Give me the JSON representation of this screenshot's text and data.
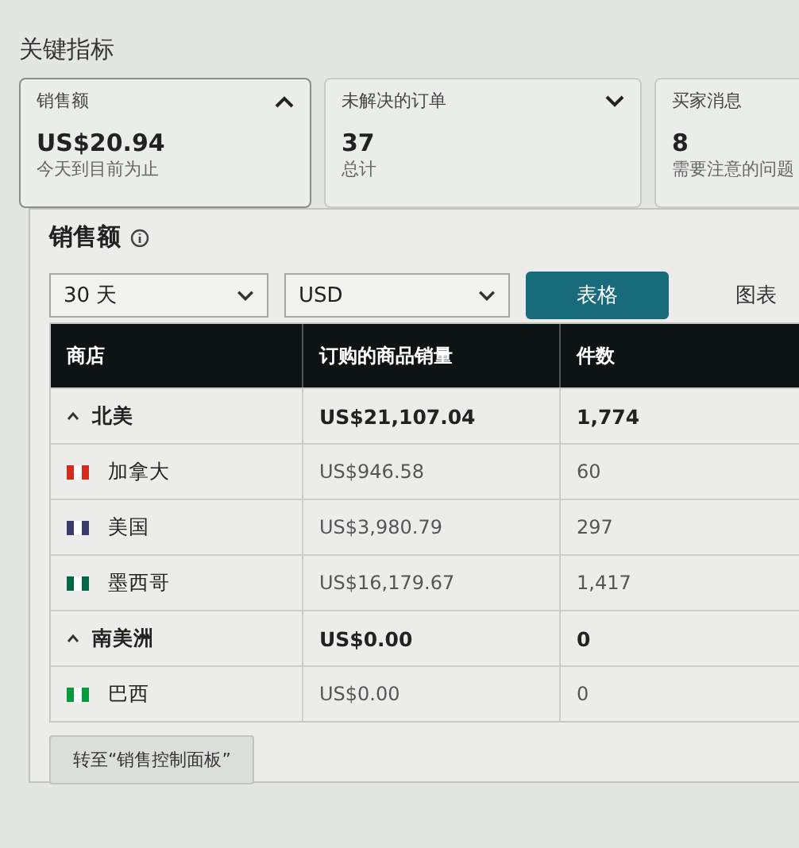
{
  "heading": "关键指标",
  "cards": [
    {
      "title": "销售额",
      "value": "US$20.94",
      "caption": "今天到目前为止",
      "expanded": true
    },
    {
      "title": "未解决的订单",
      "value": "37",
      "caption": "总计",
      "expanded": false
    },
    {
      "title": "买家消息",
      "value": "8",
      "caption": "需要注意的问题"
    }
  ],
  "panel": {
    "title": "销售额",
    "period": "30 天",
    "currency": "USD",
    "tabs": [
      {
        "label": "表格",
        "selected": true
      },
      {
        "label": "图表",
        "selected": false
      }
    ],
    "table": {
      "columns": [
        "商店",
        "订购的商品销量",
        "件数"
      ],
      "groups": [
        {
          "name": "北美",
          "sales": "US$21,107.04",
          "units": "1,774",
          "expanded": true,
          "children": [
            {
              "name": "加拿大",
              "sales": "US$946.58",
              "units": "60",
              "color": "#d52b1e"
            },
            {
              "name": "美国",
              "sales": "US$3,980.79",
              "units": "297",
              "color": "#3c3b6e"
            },
            {
              "name": "墨西哥",
              "sales": "US$16,179.67",
              "units": "1,417",
              "color": "#006847"
            }
          ]
        },
        {
          "name": "南美洲",
          "sales": "US$0.00",
          "units": "0",
          "expanded": true,
          "children": [
            {
              "name": "巴西",
              "sales": "US$0.00",
              "units": "0",
              "color": "#009c3b"
            }
          ]
        }
      ]
    },
    "button": "转至“销售控制面板”"
  }
}
